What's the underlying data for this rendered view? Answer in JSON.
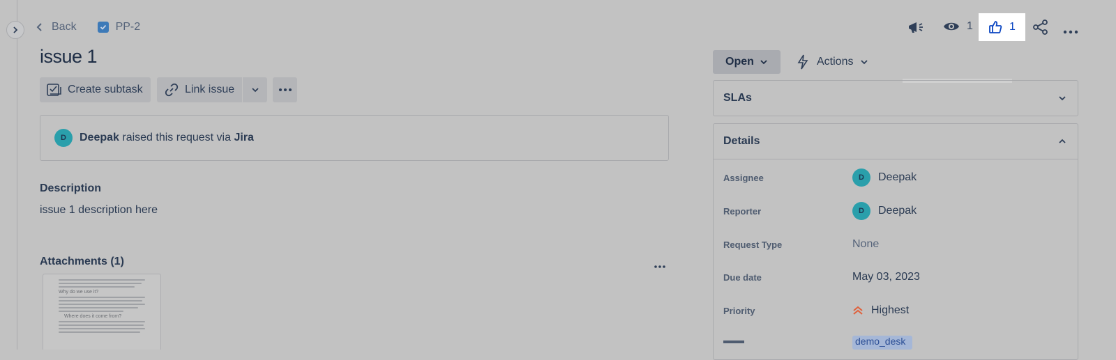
{
  "nav": {
    "back_label": "Back",
    "issue_key": "PP-2"
  },
  "issue": {
    "title": "issue 1"
  },
  "toolbar": {
    "create_subtask_label": "Create subtask",
    "link_issue_label": "Link issue"
  },
  "request": {
    "reporter_name": "Deepak",
    "raised_text": "raised this request via",
    "channel": "Jira",
    "avatar_initial": "D"
  },
  "description": {
    "heading": "Description",
    "body": "issue 1 description here"
  },
  "attachments": {
    "heading": "Attachments (1)",
    "thumbnail_headings": [
      "Why do we use it?",
      "Where does it come from?"
    ]
  },
  "header_actions": {
    "watch_count": "1",
    "like_count": "1"
  },
  "status": {
    "label": "Open",
    "actions_label": "Actions"
  },
  "slas": {
    "heading": "SLAs"
  },
  "details": {
    "heading": "Details",
    "fields": [
      {
        "label": "Assignee",
        "value": "Deepak",
        "avatar": "D"
      },
      {
        "label": "Reporter",
        "value": "Deepak",
        "avatar": "D"
      },
      {
        "label": "Request Type",
        "value": "None"
      },
      {
        "label": "Due date",
        "value": "May 03, 2023"
      },
      {
        "label": "Priority",
        "value": "Highest"
      }
    ],
    "labels_value": "demo_desk"
  },
  "colors": {
    "like_accent": "#0b46c2",
    "avatar": "#2a9fab",
    "priority_highest": "#e0603a"
  }
}
